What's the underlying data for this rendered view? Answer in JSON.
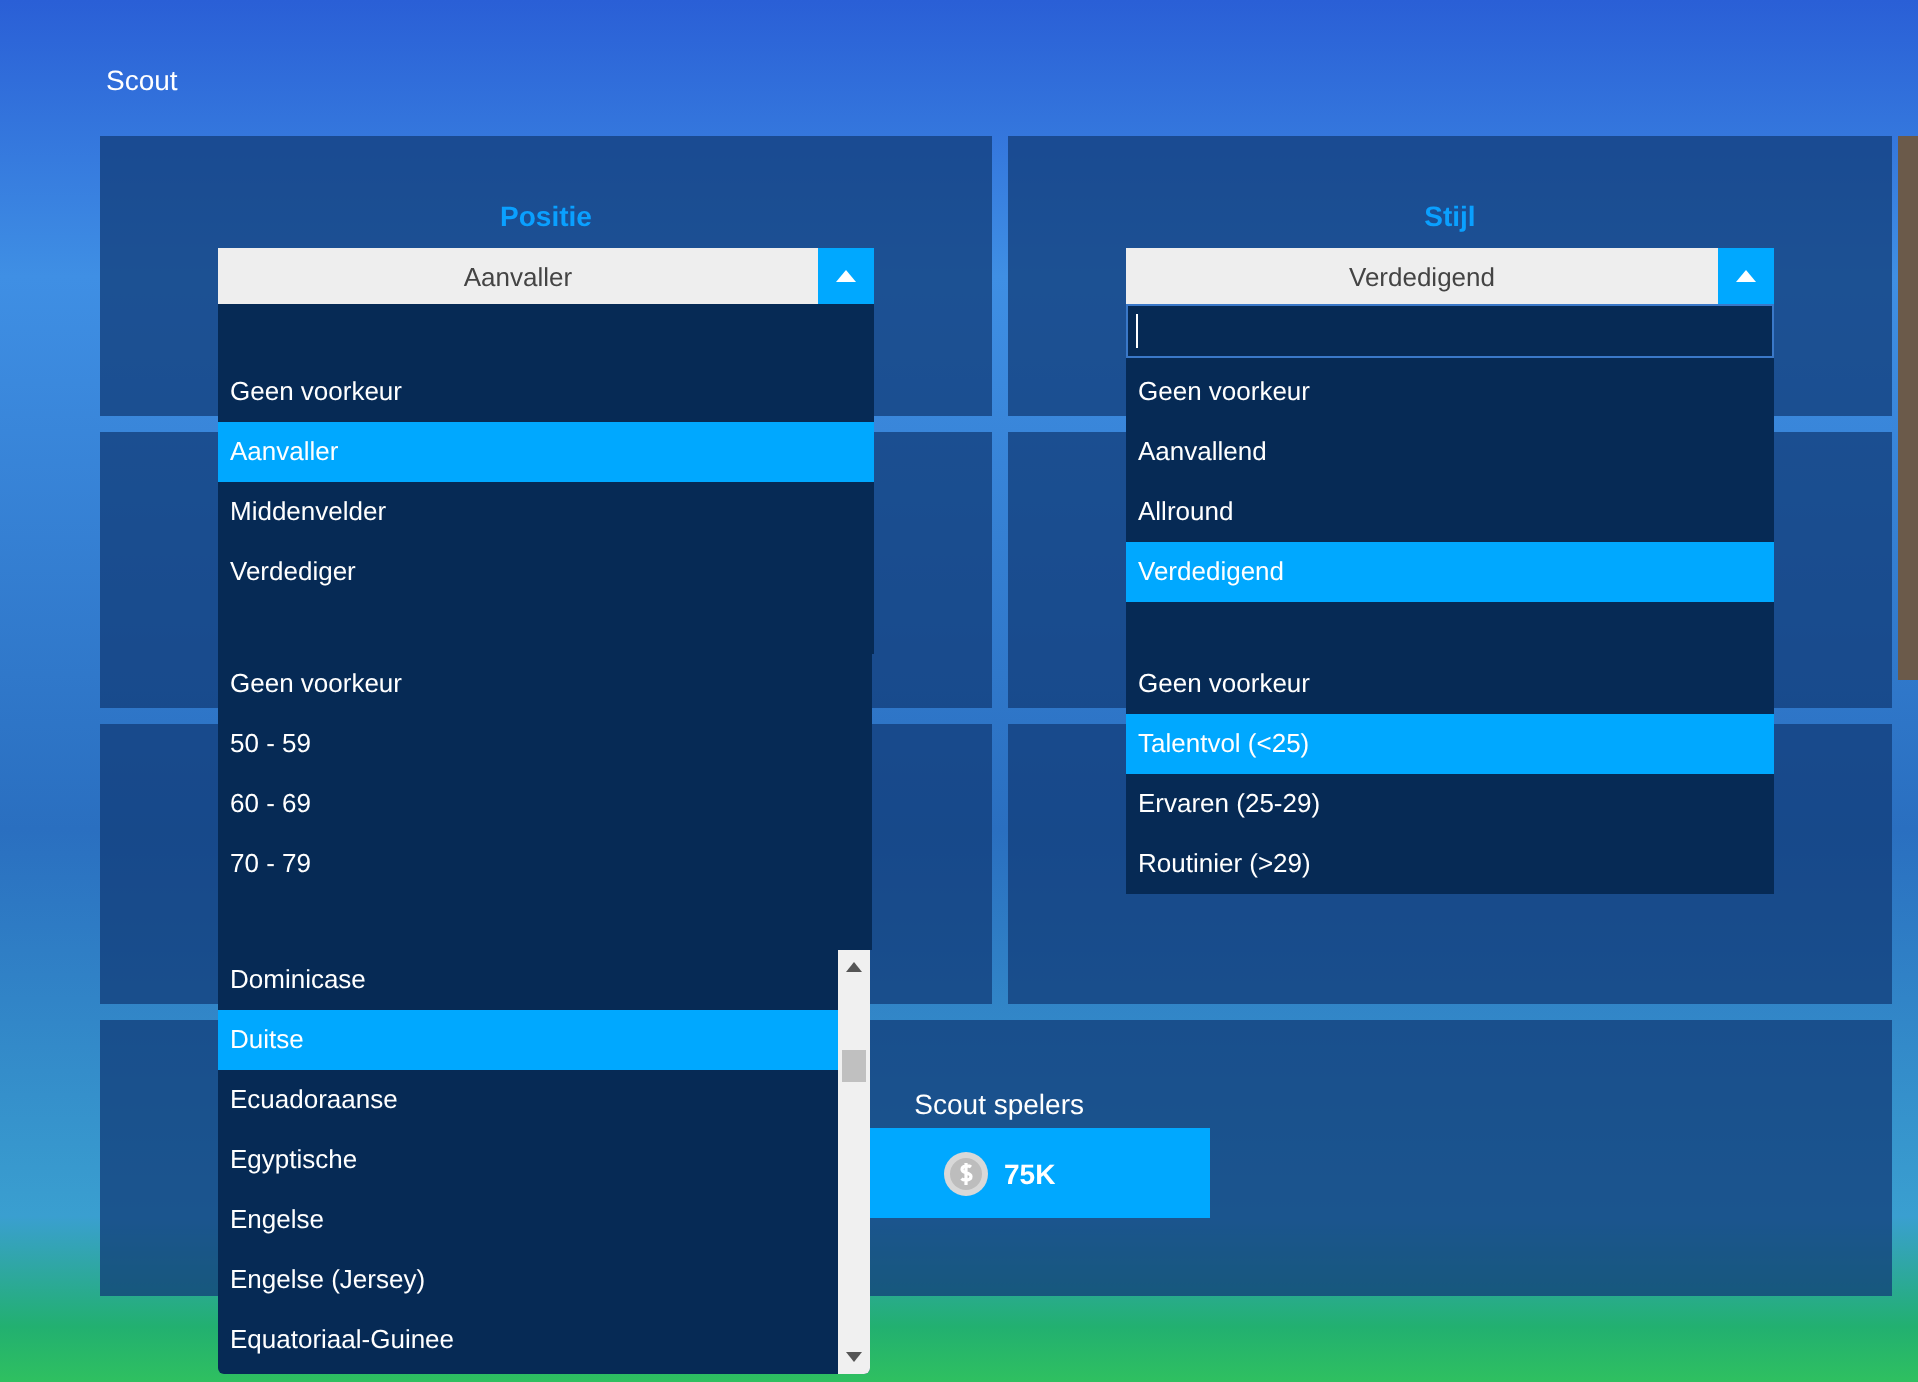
{
  "title": "Scout",
  "filters": [
    {
      "label": "Positie",
      "value": "Aanvaller",
      "search_focused": false,
      "options": [
        {
          "label": "Geen voorkeur",
          "selected": false
        },
        {
          "label": "Aanvaller",
          "selected": true
        },
        {
          "label": "Middenvelder",
          "selected": false
        },
        {
          "label": "Verdediger",
          "selected": false
        }
      ]
    },
    {
      "label": "Stijl",
      "value": "Verdedigend",
      "search_focused": true,
      "options": [
        {
          "label": "Geen voorkeur",
          "selected": false
        },
        {
          "label": "Aanvallend",
          "selected": false
        },
        {
          "label": "Allround",
          "selected": false
        },
        {
          "label": "Verdedigend",
          "selected": true
        }
      ]
    }
  ],
  "quality_list": [
    {
      "label": "Geen voorkeur",
      "selected": false
    },
    {
      "label": "50 - 59",
      "selected": false
    },
    {
      "label": "60 - 69",
      "selected": false
    },
    {
      "label": "70 - 79",
      "selected": false
    }
  ],
  "age_list": [
    {
      "label": "Geen voorkeur",
      "selected": false
    },
    {
      "label": "Talentvol (<25)",
      "selected": true
    },
    {
      "label": "Ervaren (25-29)",
      "selected": false
    },
    {
      "label": "Routinier (>29)",
      "selected": false
    }
  ],
  "nationality_list": [
    {
      "label": "Dominicase",
      "selected": false
    },
    {
      "label": "Duitse",
      "selected": true
    },
    {
      "label": "Ecuadoraanse",
      "selected": false
    },
    {
      "label": "Egyptische",
      "selected": false
    },
    {
      "label": "Engelse",
      "selected": false
    },
    {
      "label": "Engelse (Jersey)",
      "selected": false
    },
    {
      "label": "Equatoriaal-Guinee",
      "selected": false
    }
  ],
  "scout_action": {
    "label": "Scout spelers",
    "price": "75K"
  }
}
